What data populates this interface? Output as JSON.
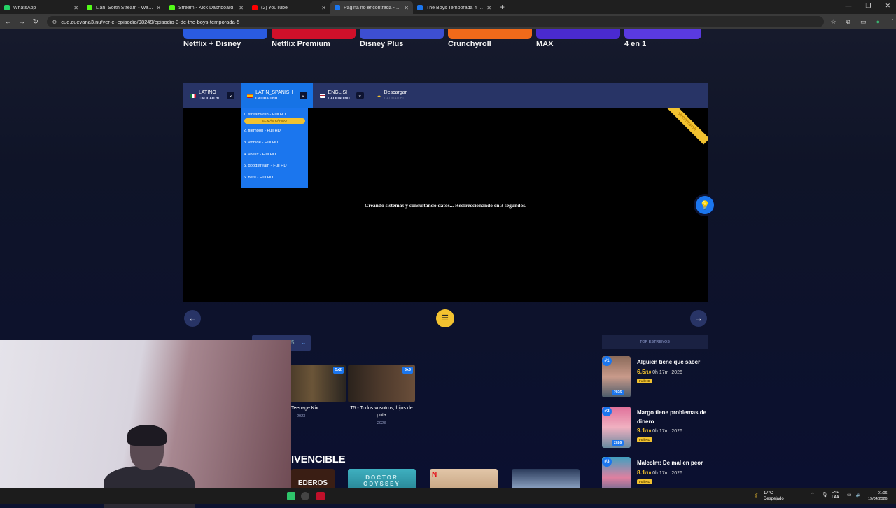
{
  "browser": {
    "tabs": [
      {
        "label": "WhatsApp",
        "color": "#25d366",
        "active": false
      },
      {
        "label": "Lian_Sorth Stream - Watch Live",
        "color": "#53fc18",
        "active": false
      },
      {
        "label": "Stream - Kick Dashboard",
        "color": "#53fc18",
        "active": false
      },
      {
        "label": "(2) YouTube",
        "color": "#ff0000",
        "active": false
      },
      {
        "label": "Página no encontrada - Cu",
        "color": "#1b76ee",
        "active": true
      },
      {
        "label": "The Boys Temporada 4 - Ver ep",
        "color": "#1b76ee",
        "active": false
      }
    ],
    "url": "cue.cuevana3.nu/ver-el-episodio/98249/episodio-3-de-the-boys-temporada-5"
  },
  "promos": [
    {
      "label": "Netflix + Disney",
      "color": "#2a5be0"
    },
    {
      "label": "Netflix Premium",
      "color": "#d0102a"
    },
    {
      "label": "Disney Plus",
      "color": "#3d4fd1"
    },
    {
      "label": "Crunchyroll",
      "color": "#f06a1a"
    },
    {
      "label": "MAX",
      "color": "#4a2ad0"
    },
    {
      "label": "4 en 1",
      "color": "#5a3ae0"
    }
  ],
  "player": {
    "languages": [
      {
        "name": "LATINO",
        "quality": "CALIDAD HD"
      },
      {
        "name": "LATIN_SPANISH",
        "quality": "CALIDAD HD"
      },
      {
        "name": "ENGLISH",
        "quality": "CALIDAD HD"
      }
    ],
    "download": {
      "label": "Descargar",
      "quality": "CALIDAD HD"
    },
    "ribbon": "streamwish",
    "message": "Creando sistemas y consultando datos... Redireccionando en 3 segundos.",
    "servers": [
      "1. streamwish - Full HD",
      "2. filemoon - Full HD",
      "3. vidhide - Full HD",
      "4. voesx - Full HD",
      "5. doodstream - Full HD",
      "6. netu - Full HD"
    ],
    "fastest_badge": "EL MÁS RÁPIDO"
  },
  "episodes": [
    {
      "title": "Teenage Kix",
      "year": "2023",
      "badge": "5x2"
    },
    {
      "title": "T5 - Todos vosotros, hijos de puta",
      "year": "2023",
      "badge": "5x3"
    }
  ],
  "season_select": {
    "value": "5"
  },
  "section_title": "IVENCIBLE",
  "related": [
    {
      "label": "EDEROS"
    },
    {
      "label": "DOCTOR ODYSSEY"
    },
    {
      "label": ""
    },
    {
      "label": ""
    }
  ],
  "top": {
    "header": "TOP ESTRENOS",
    "items": [
      {
        "rank": "#1",
        "title": "Alguien tiene que saber",
        "score": "6.5",
        "scale": "/10",
        "duration": "0h 17m",
        "year": "2026",
        "quality": "Full HD"
      },
      {
        "rank": "#2",
        "title": "Margo tiene problemas de dinero",
        "score": "9.1",
        "scale": "/10",
        "duration": "0h 17m",
        "year": "2026",
        "quality": "Full HD"
      },
      {
        "rank": "#3",
        "title": "Malcolm: De mal en peor",
        "score": "8.1",
        "scale": "/10",
        "duration": "0h 17m",
        "year": "2026",
        "quality": "Full HD"
      }
    ]
  },
  "taskbar": {
    "weather_temp": "17°C",
    "weather_desc": "Despejado",
    "lang_top": "ESP",
    "lang_bottom": "LAA",
    "time": "01:06",
    "date": "19/04/2026"
  }
}
